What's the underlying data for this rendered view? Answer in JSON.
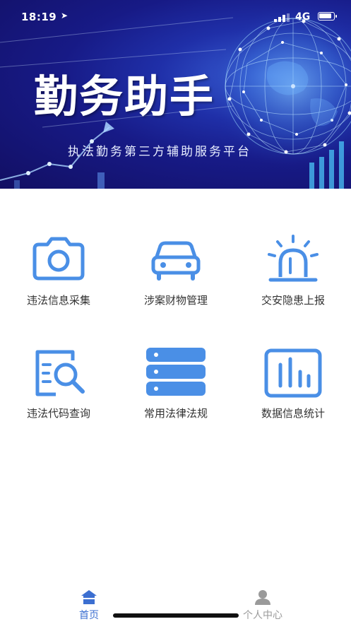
{
  "status_bar": {
    "time": "18:19",
    "network": "4G"
  },
  "banner": {
    "title": "勤务助手",
    "subtitle": "执法勤务第三方辅助服务平台"
  },
  "grid": {
    "items": [
      {
        "label": "违法信息采集",
        "icon": "camera-icon"
      },
      {
        "label": "涉案财物管理",
        "icon": "car-icon"
      },
      {
        "label": "交安隐患上报",
        "icon": "alarm-light-icon"
      },
      {
        "label": "违法代码查询",
        "icon": "document-search-icon"
      },
      {
        "label": "常用法律法规",
        "icon": "database-icon"
      },
      {
        "label": "数据信息统计",
        "icon": "bar-chart-icon"
      }
    ]
  },
  "tabbar": {
    "home_label": "首页",
    "profile_label": "个人中心",
    "active": "home"
  },
  "colors": {
    "accent": "#4a8fe6",
    "tab_active": "#3c6fd1",
    "tab_inactive": "#9a9a9a",
    "banner_dark": "#171a86"
  }
}
